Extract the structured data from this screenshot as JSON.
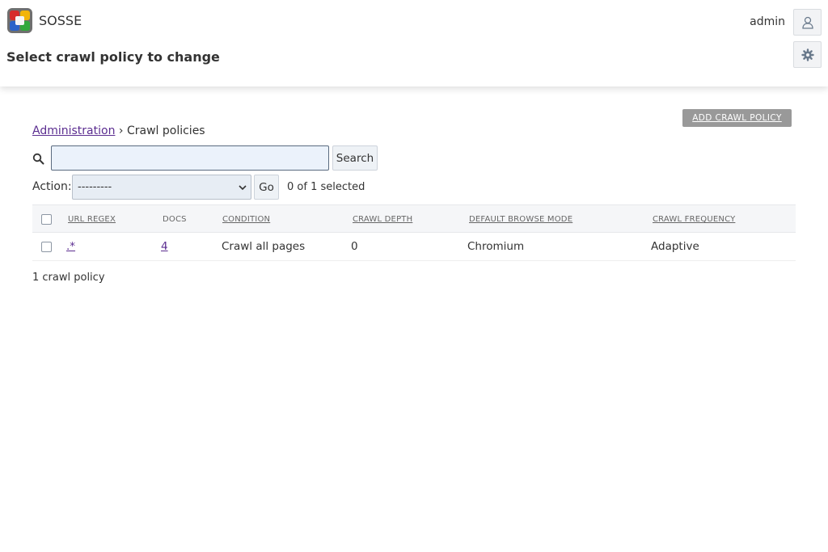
{
  "app": {
    "name": "SOSSE",
    "logo_colors": [
      "#d62b2b",
      "#f2b40a",
      "#2a62c9",
      "#31a83b"
    ]
  },
  "header": {
    "title": "Select crawl policy to change",
    "user": "admin",
    "icons": {
      "user": "user-icon",
      "settings": "gear-icon"
    }
  },
  "actions": {
    "add_label": "ADD CRAWL POLICY"
  },
  "breadcrumb": {
    "root": "Administration",
    "separator": "›",
    "current": "Crawl policies"
  },
  "search": {
    "value": "",
    "button_label": "Search",
    "icon": "search-icon"
  },
  "bulk_action": {
    "label": "Action:",
    "selected_option": "---------",
    "go_label": "Go",
    "selection_status": "0 of 1 selected"
  },
  "table": {
    "columns": [
      "URL REGEX",
      "DOCS",
      "CONDITION",
      "CRAWL DEPTH",
      "DEFAULT BROWSE MODE",
      "CRAWL FREQUENCY"
    ],
    "rows": [
      {
        "url_regex": ".*",
        "docs": "4",
        "condition": "Crawl all pages",
        "crawl_depth": "0",
        "browse_mode": "Chromium",
        "frequency": "Adaptive"
      }
    ]
  },
  "footer": {
    "count_text": "1 crawl policy"
  },
  "colors": {
    "link": "#5b2d90",
    "add_button_bg": "#999999",
    "search_input_bg": "#ebf2fb",
    "table_header_bg": "#f5f6f8"
  }
}
